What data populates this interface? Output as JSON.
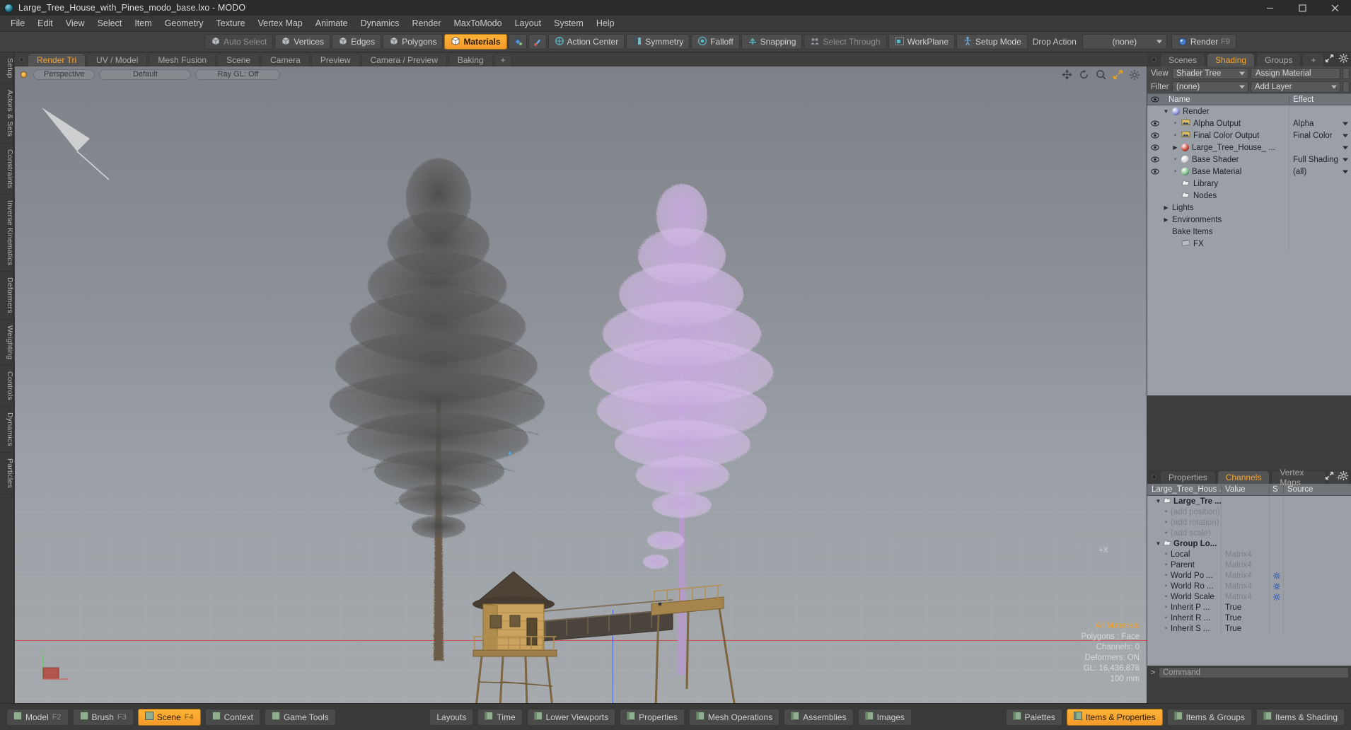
{
  "window": {
    "title": "Large_Tree_House_with_Pines_modo_base.lxo - MODO",
    "app_icon": "modo-sphere-icon",
    "minimize": "minimize-button",
    "maximize": "maximize-button",
    "close": "close-button"
  },
  "menubar": {
    "items": [
      "File",
      "Edit",
      "View",
      "Select",
      "Item",
      "Geometry",
      "Texture",
      "Vertex Map",
      "Animate",
      "Dynamics",
      "Render",
      "MaxToModo",
      "Layout",
      "System",
      "Help"
    ]
  },
  "toolbar": {
    "select_modes": [
      {
        "label": "Auto Select",
        "active": false,
        "dim": true,
        "icon": "cube-icon"
      },
      {
        "label": "Vertices",
        "active": false,
        "dim": false,
        "icon": "cube-vertex-icon"
      },
      {
        "label": "Edges",
        "active": false,
        "dim": false,
        "icon": "cube-edge-icon"
      },
      {
        "label": "Polygons",
        "active": false,
        "dim": false,
        "icon": "cube-polygon-icon"
      },
      {
        "label": "Materials",
        "active": true,
        "dim": false,
        "icon": "cube-material-icon"
      }
    ],
    "icon_buttons": [
      "paint-bucket-icon",
      "paint-brush-icon"
    ],
    "mode_buttons": [
      {
        "label": "Action Center",
        "icon": "action-center-icon",
        "dim": false
      },
      {
        "label": "Symmetry",
        "icon": "symmetry-icon",
        "dim": false
      },
      {
        "label": "Falloff",
        "icon": "falloff-icon",
        "dim": false
      },
      {
        "label": "Snapping",
        "icon": "snapping-icon",
        "dim": false
      },
      {
        "label": "Select Through",
        "icon": "select-through-icon",
        "dim": true
      },
      {
        "label": "WorkPlane",
        "icon": "workplane-icon",
        "dim": false
      },
      {
        "label": "Setup Mode",
        "icon": "setup-mode-icon",
        "dim": false
      }
    ],
    "drop_action_label": "Drop Action",
    "drop_action_value": "(none)",
    "render_label": "Render",
    "render_hotkey": "F9",
    "render_icon": "render-sphere-icon"
  },
  "left_rail": {
    "items": [
      "Setup",
      "Actors & Sets",
      "Constraints",
      "Inverse Kinematics",
      "Deformers",
      "Weighting",
      "Controls",
      "Dynamics",
      "Particles"
    ]
  },
  "viewport": {
    "tabs": [
      {
        "label": "Render Tri",
        "active": true
      },
      {
        "label": "UV / Model",
        "active": false
      },
      {
        "label": "Mesh Fusion",
        "active": false
      },
      {
        "label": "Scene",
        "active": false
      },
      {
        "label": "Camera",
        "active": false
      },
      {
        "label": "Preview",
        "active": false
      },
      {
        "label": "Camera / Preview",
        "active": false
      },
      {
        "label": "Baking",
        "active": false
      },
      {
        "label": "+",
        "active": false
      }
    ],
    "header": {
      "view_mode": "Perspective",
      "shading_style": "Default",
      "ray_gl": "Ray GL: Off"
    },
    "nav_icons": [
      "pan-icon",
      "rotate-icon",
      "zoom-icon",
      "fit-icon",
      "viewport-settings-icon"
    ],
    "axis_label": "+X",
    "info": {
      "selection": "All Materials",
      "polygons": "Polygons : Face",
      "channels": "Channels: 0",
      "deformers": "Deformers: ON",
      "gl": "GL: 16,436,878",
      "grid": "100 mm"
    },
    "gizmo_axes": [
      "Y",
      "X"
    ],
    "scene_description": "Two tall pine trees with a wooden tree house and elevated walkway platform"
  },
  "shading_panel": {
    "tabs": [
      {
        "label": "Scenes",
        "active": false
      },
      {
        "label": "Shading",
        "active": true
      },
      {
        "label": "Groups",
        "active": false
      },
      {
        "label": "+",
        "active": false
      }
    ],
    "corner_icons": [
      "expand-icon",
      "gear-icon"
    ],
    "view_label": "View",
    "view_value": "Shader Tree",
    "assign_material_label": "Assign Material",
    "filter_label": "Filter",
    "filter_value": "(none)",
    "add_layer_label": "Add Layer",
    "columns": {
      "name": "Name",
      "effect": "Effect"
    },
    "rows": [
      {
        "indent": 0,
        "twisty": "down",
        "icon": "render-sphere-icon",
        "color": "#8a92d8",
        "name": "Render",
        "effect": "",
        "eye": false,
        "has_caret": false
      },
      {
        "indent": 1,
        "twisty": "dot",
        "icon": "image-output-icon",
        "color": "#e0c060",
        "name": "Alpha Output",
        "effect": "Alpha",
        "eye": true,
        "has_caret": true
      },
      {
        "indent": 1,
        "twisty": "dot",
        "icon": "image-output-icon",
        "color": "#e0c060",
        "name": "Final Color Output",
        "effect": "Final Color",
        "eye": true,
        "has_caret": true
      },
      {
        "indent": 1,
        "twisty": "right",
        "icon": "material-sphere-icon",
        "color": "#cf4a3a",
        "name": "Large_Tree_House_ ...",
        "effect": "",
        "eye": true,
        "has_caret": true
      },
      {
        "indent": 1,
        "twisty": "dot",
        "icon": "shader-sphere-icon",
        "color": "#d5d5d5",
        "name": "Base Shader",
        "effect": "Full Shading",
        "eye": true,
        "has_caret": true
      },
      {
        "indent": 1,
        "twisty": "dot",
        "icon": "material-sphere-icon",
        "color": "#7fc48a",
        "name": "Base Material",
        "effect": "(all)",
        "eye": true,
        "has_caret": true
      },
      {
        "indent": 1,
        "twisty": "none",
        "icon": "folder-icon",
        "color": "#cfd4d8",
        "name": "Library",
        "effect": "",
        "eye": false,
        "has_caret": false
      },
      {
        "indent": 1,
        "twisty": "none",
        "icon": "folder-icon",
        "color": "#cfd4d8",
        "name": "Nodes",
        "effect": "",
        "eye": false,
        "has_caret": false
      },
      {
        "indent": 0,
        "twisty": "right",
        "icon": "none",
        "color": "",
        "name": "Lights",
        "effect": "",
        "eye": false,
        "has_caret": false
      },
      {
        "indent": 0,
        "twisty": "right",
        "icon": "none",
        "color": "",
        "name": "Environments",
        "effect": "",
        "eye": false,
        "has_caret": false
      },
      {
        "indent": 0,
        "twisty": "none",
        "icon": "none",
        "color": "",
        "name": "Bake Items",
        "effect": "",
        "eye": false,
        "has_caret": false
      },
      {
        "indent": 1,
        "twisty": "none",
        "icon": "fx-clapper-icon",
        "color": "#b9bec2",
        "name": "FX",
        "effect": "",
        "eye": false,
        "has_caret": false
      }
    ]
  },
  "channels_panel": {
    "tabs": [
      {
        "label": "Properties",
        "active": false
      },
      {
        "label": "Channels",
        "active": true
      },
      {
        "label": "Vertex Maps",
        "active": false
      },
      {
        "label": "+",
        "active": false
      }
    ],
    "corner_icons": [
      "expand-icon",
      "gear-icon"
    ],
    "columns": [
      "Large_Tree_Hous ...",
      "Value",
      "S",
      "Source"
    ],
    "rows": [
      {
        "indent": 0,
        "twisty": "down",
        "icon": "folder-icon",
        "name": "Large_Tre ...",
        "value": "",
        "bold": true,
        "muted": false,
        "gear": false
      },
      {
        "indent": 1,
        "twisty": "dot",
        "icon": "none",
        "name": "(add position)",
        "value": "",
        "bold": false,
        "muted": true,
        "gear": false
      },
      {
        "indent": 1,
        "twisty": "dot",
        "icon": "none",
        "name": "(add rotation)",
        "value": "",
        "bold": false,
        "muted": true,
        "gear": false
      },
      {
        "indent": 1,
        "twisty": "dot",
        "icon": "none",
        "name": "(add scale)",
        "value": "",
        "bold": false,
        "muted": true,
        "gear": false
      },
      {
        "indent": 0,
        "twisty": "down",
        "icon": "folder-icon",
        "name": "Group Lo...",
        "value": "",
        "bold": true,
        "muted": false,
        "gear": false
      },
      {
        "indent": 1,
        "twisty": "dot",
        "icon": "none",
        "name": "Local",
        "value": "Matrix4",
        "bold": false,
        "muted": false,
        "gear": false
      },
      {
        "indent": 1,
        "twisty": "dot",
        "icon": "none",
        "name": "Parent",
        "value": "Matrix4",
        "bold": false,
        "muted": false,
        "gear": false
      },
      {
        "indent": 1,
        "twisty": "dot",
        "icon": "none",
        "name": "World Po ...",
        "value": "Matrix4",
        "bold": false,
        "muted": false,
        "gear": true
      },
      {
        "indent": 1,
        "twisty": "dot",
        "icon": "none",
        "name": "World Ro ...",
        "value": "Matrix4",
        "bold": false,
        "muted": false,
        "gear": true
      },
      {
        "indent": 1,
        "twisty": "dot",
        "icon": "none",
        "name": "World Scale",
        "value": "Matrix4",
        "bold": false,
        "muted": false,
        "gear": true
      },
      {
        "indent": 1,
        "twisty": "dot",
        "icon": "none",
        "name": "Inherit P ...",
        "value": "True",
        "bold": false,
        "muted": false,
        "gear": false
      },
      {
        "indent": 1,
        "twisty": "dot",
        "icon": "none",
        "name": "Inherit R ...",
        "value": "True",
        "bold": false,
        "muted": false,
        "gear": false
      },
      {
        "indent": 1,
        "twisty": "dot",
        "icon": "none",
        "name": "Inherit S ...",
        "value": "True",
        "bold": false,
        "muted": false,
        "gear": false
      }
    ],
    "command_placeholder": "Command",
    "command_value": ""
  },
  "bottombar": {
    "left_buttons": [
      {
        "label": "Model",
        "hotkey": "F2",
        "active": false,
        "icon": "layout-icon"
      },
      {
        "label": "Brush",
        "hotkey": "F3",
        "active": false,
        "icon": "layout-icon"
      },
      {
        "label": "Scene",
        "hotkey": "F4",
        "active": true,
        "icon": "layout-icon"
      },
      {
        "label": "Context",
        "hotkey": "",
        "active": false,
        "icon": "layout-icon"
      },
      {
        "label": "Game Tools",
        "hotkey": "",
        "active": false,
        "icon": "layout-icon"
      }
    ],
    "center_buttons": [
      {
        "label": "Layouts",
        "active": false,
        "icon": "none"
      },
      {
        "label": "Time",
        "active": false,
        "icon": "panel-icon"
      },
      {
        "label": "Lower Viewports",
        "active": false,
        "icon": "panel-icon"
      },
      {
        "label": "Properties",
        "active": false,
        "icon": "panel-icon"
      },
      {
        "label": "Mesh Operations",
        "active": false,
        "icon": "panel-icon"
      },
      {
        "label": "Assemblies",
        "active": false,
        "icon": "panel-icon"
      },
      {
        "label": "Images",
        "active": false,
        "icon": "panel-icon"
      }
    ],
    "right_buttons": [
      {
        "label": "Palettes",
        "active": false,
        "icon": "panel-icon"
      },
      {
        "label": "Items & Properties",
        "active": true,
        "icon": "panel-icon"
      },
      {
        "label": "Items & Groups",
        "active": false,
        "icon": "panel-icon"
      },
      {
        "label": "Items & Shading",
        "active": false,
        "icon": "panel-icon"
      }
    ]
  },
  "colors": {
    "accent": "#f2a330",
    "panel_bg": "#3e3e3e",
    "tree_bg": "#9aa0a5",
    "header_bg": "#6f7479",
    "titlebar_bg": "#2b2b2b"
  }
}
